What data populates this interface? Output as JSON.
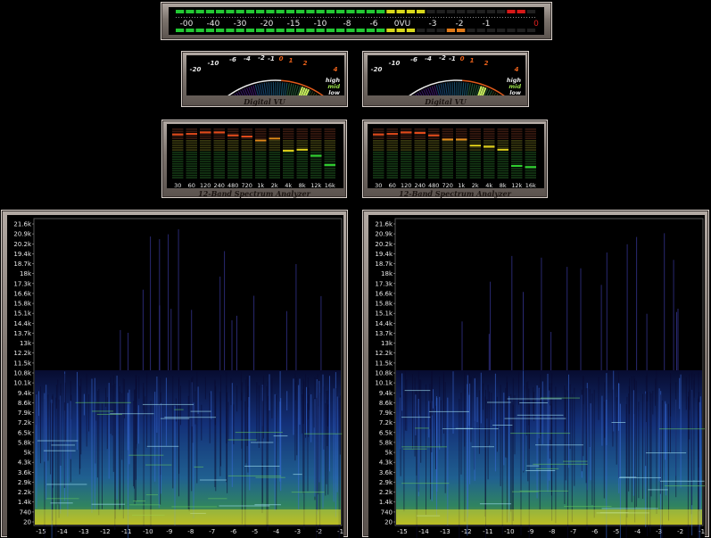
{
  "vu_bar": {
    "scale_labels": [
      "-00",
      "-40",
      "-30",
      "-20",
      "-15",
      "-10",
      "-8",
      "-6",
      "0VU",
      "-3",
      "-2",
      "-1",
      "0"
    ],
    "colors": {
      "green": "#22c833",
      "yellow": "#d8d81a",
      "orange": "#e07a18",
      "red": "#d81818",
      "off": "#202020"
    }
  },
  "digital_vu": [
    {
      "title": "Digital VU",
      "scale_labels": [
        "-20",
        "-10",
        "-6",
        "-4",
        "-2",
        "-1",
        "0",
        "1",
        "2",
        "4"
      ],
      "band_labels": [
        "high",
        "mid",
        "low"
      ]
    },
    {
      "title": "Digital VU",
      "scale_labels": [
        "-20",
        "-10",
        "-6",
        "-4",
        "-2",
        "-1",
        "0",
        "1",
        "2",
        "4"
      ],
      "band_labels": [
        "high",
        "mid",
        "low"
      ]
    }
  ],
  "spectrum": [
    {
      "title": "12-Band Spectrum Analyzer",
      "bands": [
        "30",
        "60",
        "120",
        "240",
        "480",
        "720",
        "1k",
        "2k",
        "4k",
        "8k",
        "12k",
        "16k"
      ],
      "peak_levels": [
        0.9,
        0.91,
        0.94,
        0.94,
        0.88,
        0.86,
        0.78,
        0.82,
        0.58,
        0.6,
        0.48,
        0.3
      ]
    },
    {
      "title": "12-Band Spectrum Analyzer",
      "bands": [
        "30",
        "60",
        "120",
        "240",
        "480",
        "720",
        "1k",
        "2k",
        "4k",
        "8k",
        "12k",
        "16k"
      ],
      "peak_levels": [
        0.9,
        0.91,
        0.94,
        0.93,
        0.88,
        0.8,
        0.8,
        0.68,
        0.66,
        0.6,
        0.28,
        0.26
      ]
    }
  ],
  "spectrograms": [
    {
      "y_labels": [
        "21.6k",
        "20.9k",
        "20.2k",
        "19.4k",
        "18.7k",
        "18k",
        "17.3k",
        "16.6k",
        "15.8k",
        "15.1k",
        "14.4k",
        "13.7k",
        "13k",
        "12.2k",
        "11.5k",
        "10.8k",
        "10.1k",
        "9.4k",
        "8.6k",
        "7.9k",
        "7.2k",
        "6.5k",
        "5.8k",
        "5k",
        "4.3k",
        "3.6k",
        "2.9k",
        "2.2k",
        "1.4k",
        "740",
        "20"
      ],
      "x_labels": [
        "-15",
        "-14",
        "-13",
        "-12",
        "-11",
        "-10",
        "-9",
        "-8",
        "-7",
        "-6",
        "-5",
        "-4",
        "-3",
        "-2",
        "-1"
      ]
    },
    {
      "y_labels": [
        "21.6k",
        "20.9k",
        "20.2k",
        "19.4k",
        "18.7k",
        "18k",
        "17.3k",
        "16.6k",
        "15.8k",
        "15.1k",
        "14.4k",
        "13.7k",
        "13k",
        "12.2k",
        "11.5k",
        "10.8k",
        "10.1k",
        "9.4k",
        "8.6k",
        "7.9k",
        "7.2k",
        "6.5k",
        "5.8k",
        "5k",
        "4.3k",
        "3.6k",
        "2.9k",
        "2.2k",
        "1.4k",
        "740",
        "20"
      ],
      "x_labels": [
        "-15",
        "-14",
        "-13",
        "-12",
        "-11",
        "-10",
        "-9",
        "-8",
        "-7",
        "-6",
        "-5",
        "-4",
        "-3",
        "-2",
        "-1"
      ]
    }
  ]
}
